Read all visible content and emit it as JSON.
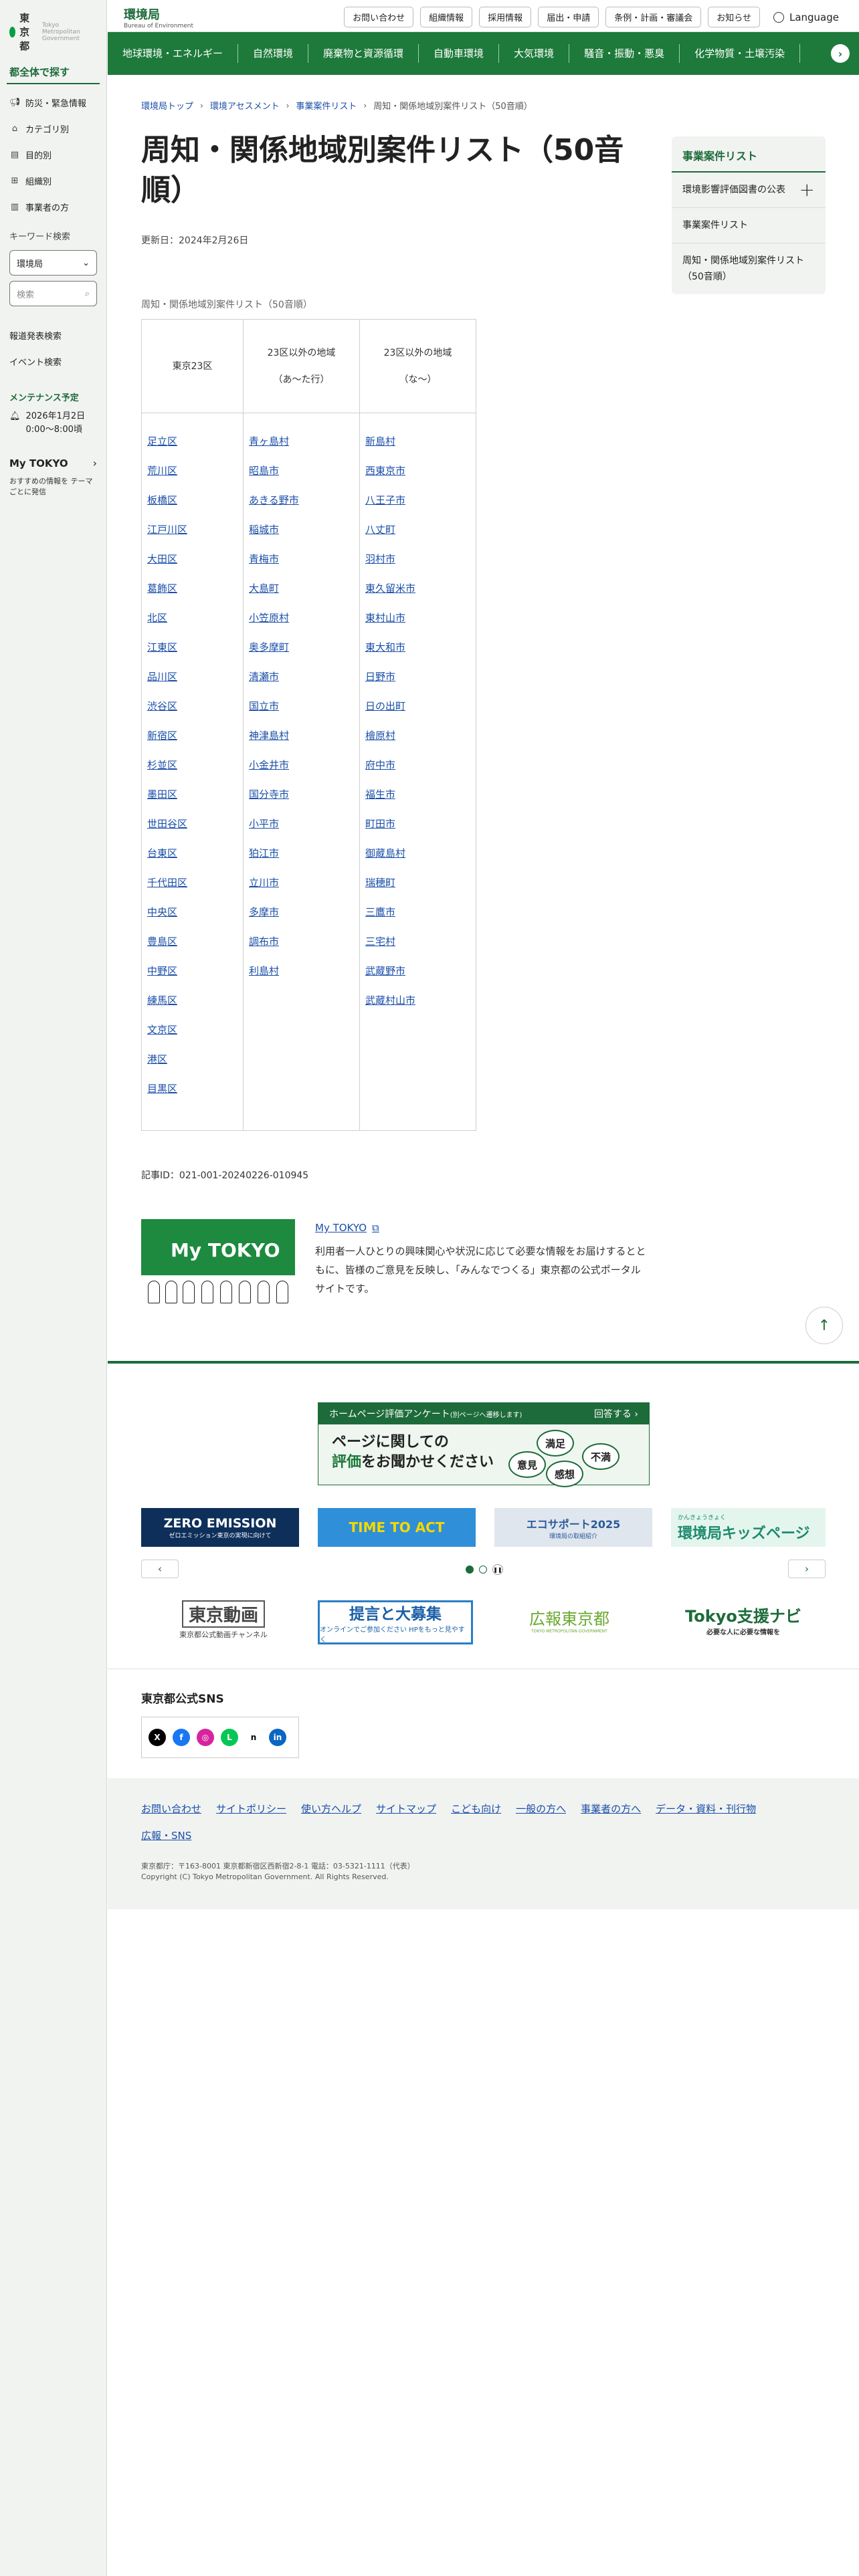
{
  "sidebar": {
    "logo_text": "東京都",
    "logo_sub": "Tokyo Metropolitan Government",
    "heading": "都全体で探す",
    "items": [
      {
        "label": "防災・緊急情報",
        "icon": "megaphone-icon"
      },
      {
        "label": "カテゴリ別",
        "icon": "tag-icon"
      },
      {
        "label": "目的別",
        "icon": "document-icon"
      },
      {
        "label": "組織別",
        "icon": "org-chart-icon"
      },
      {
        "label": "事業者の方",
        "icon": "building-icon"
      }
    ],
    "keyword_label": "キーワード検索",
    "select_value": "環境局",
    "search_placeholder": "検索",
    "links": [
      "報道発表検索",
      "イベント検索"
    ],
    "maintenance_heading": "メンテナンス予定",
    "maintenance_text": "2026年1月2日 0:00〜8:00頃",
    "mytokyo_logo": "My TOKYO",
    "mytokyo_desc": "おすすめの情報を テーマごとに発信"
  },
  "header": {
    "bureau_name": "環境局",
    "bureau_sub": "Bureau of Environment",
    "util_buttons": [
      "お問い合わせ",
      "組織情報",
      "採用情報",
      "届出・申請",
      "条例・計画・審議会",
      "お知らせ"
    ],
    "language": "Language"
  },
  "gnav": [
    "地球環境・エネルギー",
    "自然環境",
    "廃棄物と資源循環",
    "自動車環境",
    "大気環境",
    "騒音・振動・悪臭",
    "化学物質・土壌汚染"
  ],
  "breadcrumb": [
    "環境局トップ",
    "環境アセスメント",
    "事業案件リスト",
    "周知・関係地域別案件リスト（50音順）"
  ],
  "page_title": "周知・関係地域別案件リスト（50音順）",
  "updated": "更新日：2024年2月26日",
  "table": {
    "caption": "周知・関係地域別案件リスト（50音順）",
    "headers": [
      "東京23区",
      "23区以外の地域\n（あ〜た行）",
      "23区以外の地域\n（な〜）"
    ],
    "col1": [
      "足立区",
      "荒川区",
      "板橋区",
      "江戸川区",
      "大田区",
      "葛飾区",
      "北区",
      "江東区",
      "品川区",
      "渋谷区",
      "新宿区",
      "杉並区",
      "墨田区",
      "世田谷区",
      "台東区",
      "千代田区",
      "中央区",
      "豊島区",
      "中野区",
      "練馬区",
      "文京区",
      "港区",
      "目黒区"
    ],
    "col2": [
      "青ヶ島村",
      "昭島市",
      "あきる野市",
      "稲城市",
      "青梅市",
      "大島町",
      "小笠原村",
      "奥多摩町",
      "清瀬市",
      "国立市",
      "神津島村",
      "小金井市",
      "国分寺市",
      "小平市",
      "狛江市",
      "立川市",
      "多摩市",
      "調布市",
      "利島村"
    ],
    "col3": [
      "新島村",
      "西東京市",
      "八王子市",
      "八丈町",
      "羽村市",
      "東久留米市",
      "東村山市",
      "東大和市",
      "日野市",
      "日の出町",
      "檜原村",
      "府中市",
      "福生市",
      "町田市",
      "御蔵島村",
      "瑞穂町",
      "三鷹市",
      "三宅村",
      "武蔵野市",
      "武蔵村山市"
    ]
  },
  "article_id": "記事ID：021-001-20240226-010945",
  "mytokyo": {
    "image_text": "My TOKYO",
    "link": "My TOKYO",
    "description": "利用者一人ひとりの興味関心や状況に応じて必要な情報をお届けするとともに、皆様のご意見を反映し、「みんなでつくる」東京都の公式ポータルサイトです。"
  },
  "sidenav": {
    "heading": "事業案件リスト",
    "items": [
      "環境影響評価図書の公表",
      "事業案件リスト",
      "周知・関係地域別案件リスト（50音順）"
    ]
  },
  "survey": {
    "title": "ホームページ評価アンケート",
    "title_note": "(別ページへ遷移します)",
    "answer": "回答する",
    "line1": "ページに関しての",
    "line2_hl": "評価",
    "line2_rest": "をお聞かせください",
    "bubbles": [
      "満足",
      "意見",
      "不満",
      "感想"
    ]
  },
  "banners": {
    "zero_title": "ZERO EMISSION",
    "zero_sub": "ゼロエミッション東京の実現に向けて",
    "time_to_act": "TIME TO ACT",
    "ecosupport": "エコサポート2025",
    "ecosupport_sub": "環境局の取組紹介",
    "kids_small": "かんきょうきょく",
    "kids": "環境局キッズページ",
    "tokyo_douga": "東京動画",
    "tokyo_douga_sub": "東京都公式動画チャンネル",
    "teigen": "提言と大募集",
    "teigen_sub": "オンラインでご参加ください HPをもっと見やすく",
    "kouhou": "広報東京都",
    "kouhou_sub": "TOKYO METROPOLITAN GOVERNMENT",
    "shien": "Tokyo支援ナビ",
    "shien_sub": "必要な人に必要な情報を"
  },
  "sns": {
    "title": "東京都公式SNS",
    "items": [
      {
        "name": "x-icon",
        "glyph": "X",
        "color": "#000000"
      },
      {
        "name": "facebook-icon",
        "glyph": "f",
        "color": "#1877f2"
      },
      {
        "name": "instagram-icon",
        "glyph": "◎",
        "color": "#d6249f"
      },
      {
        "name": "line-icon",
        "glyph": "L",
        "color": "#06c755"
      },
      {
        "name": "note-icon",
        "glyph": "n",
        "color": "#ffffff"
      },
      {
        "name": "linkedin-icon",
        "glyph": "in",
        "color": "#0a66c2"
      }
    ]
  },
  "footer": {
    "links": [
      "お問い合わせ",
      "サイトポリシー",
      "使い方ヘルプ",
      "サイトマップ",
      "こども向け",
      "一般の方へ",
      "事業者の方へ",
      "データ・資料・刊行物",
      "広報・SNS"
    ],
    "address": "東京都庁：〒163-8001 東京都新宿区西新宿2-8-1 電話：03-5321-1111（代表）",
    "copyright": "Copyright (C) Tokyo Metropolitan Government. All Rights Reserved."
  },
  "colors": {
    "brand_green": "#1d6b3a",
    "nav_green": "#1d7a3a",
    "link_blue": "#1a4ea8"
  }
}
